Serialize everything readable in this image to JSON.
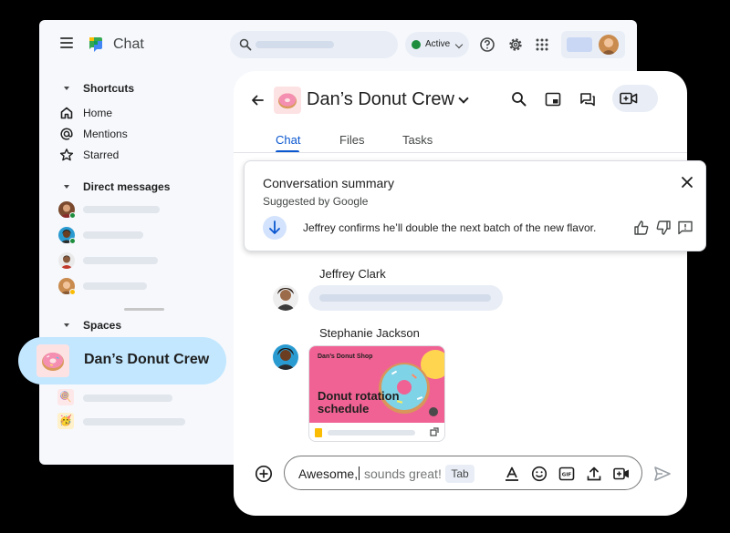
{
  "app": {
    "title": "Chat",
    "status_label": "Active",
    "accent": "#0b57d0",
    "active_green": "#1e8e3e"
  },
  "sidebar": {
    "shortcuts_heading": "Shortcuts",
    "shortcuts": [
      {
        "label": "Home",
        "icon": "home-icon"
      },
      {
        "label": "Mentions",
        "icon": "at-icon"
      },
      {
        "label": "Starred",
        "icon": "star-icon"
      }
    ],
    "dm_heading": "Direct messages",
    "spaces_heading": "Spaces",
    "active_space": {
      "label": "Dan’s Donut Crew",
      "emoji": "🍩"
    },
    "space_emojis": [
      "🍭",
      "🥳"
    ]
  },
  "conversation": {
    "title": "Dan’s Donut Crew",
    "emoji": "🍩",
    "tabs": [
      "Chat",
      "Files",
      "Tasks"
    ],
    "active_tab": "Chat"
  },
  "summary": {
    "title": "Conversation summary",
    "subtitle": "Suggested by Google",
    "text": "Jeffrey confirms he’ll double the next batch of the new flavor."
  },
  "messages": [
    {
      "sender": "Jeffrey Clark"
    },
    {
      "sender": "Stephanie Jackson",
      "attachment": {
        "shop": "Dan’s Donut Shop",
        "heading": "Donut rotation schedule"
      }
    }
  ],
  "composer": {
    "typed": "Awesome,",
    "suggestion": " sounds great!",
    "hint": "Tab"
  }
}
